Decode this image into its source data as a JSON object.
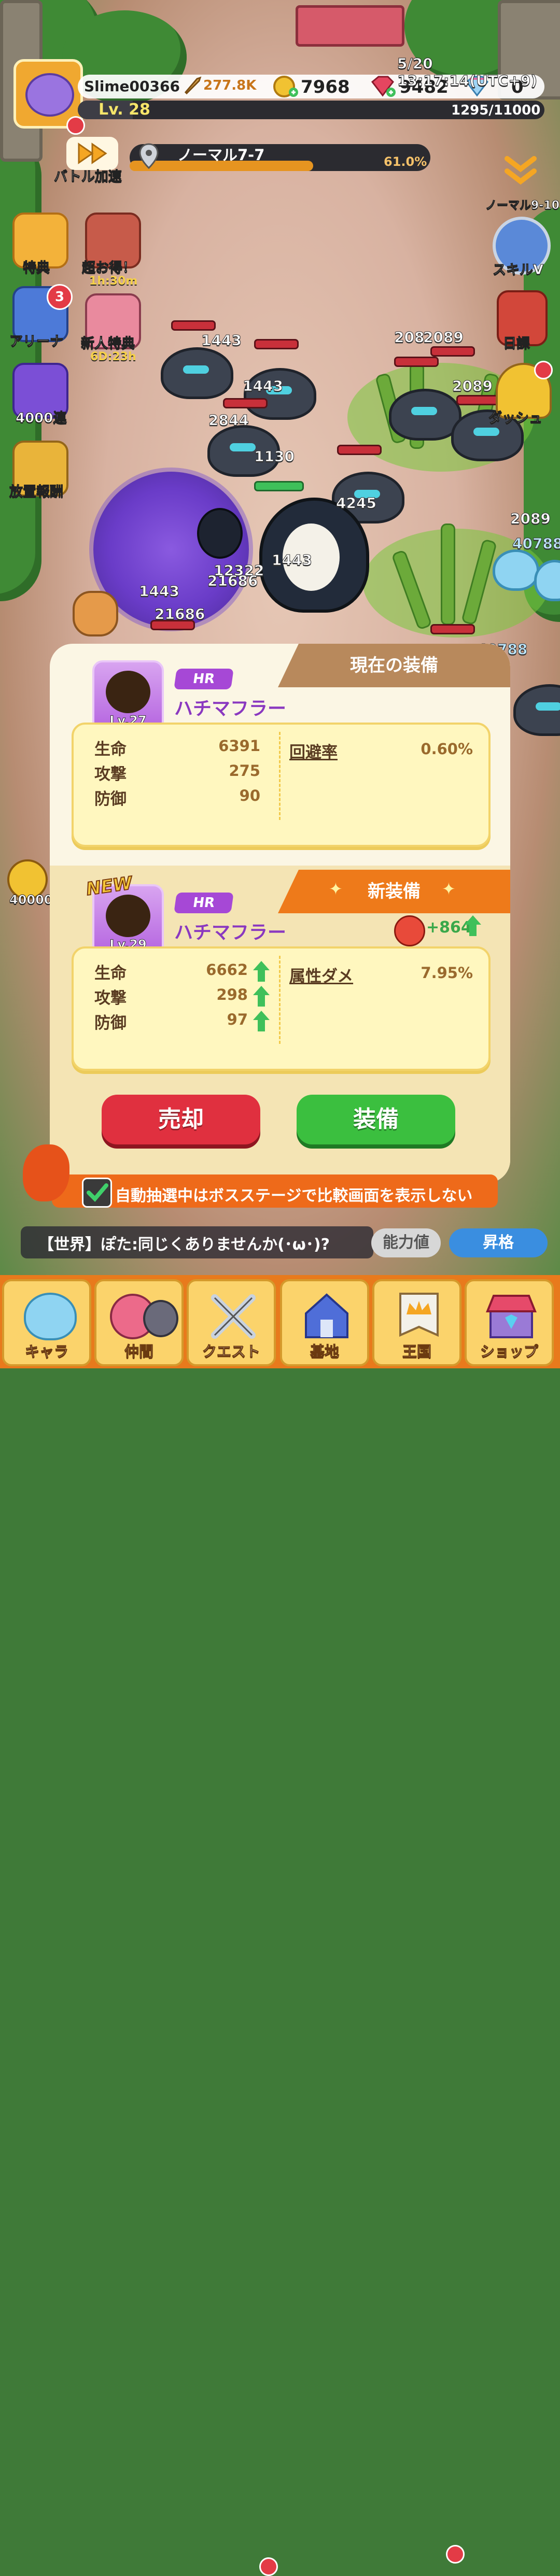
{
  "player": {
    "name": "Slime00366",
    "power": "277.8K",
    "level": "Lv. 28",
    "exp": "1295/11000",
    "exp_fraction": 0.1177
  },
  "currencies": {
    "gold": "7968",
    "gems": "9482",
    "diamonds": "0"
  },
  "server_time": "5/20 13:17:14(UTC+9)",
  "stage": {
    "name": "ノーマル7-7",
    "progress_label": "61.0%",
    "progress_fraction": 0.61,
    "next_stage": "ノーマル9-10"
  },
  "battle_speed_label": "バトル加速",
  "left_menu": {
    "perks": "特典",
    "super_deal": "超お得！",
    "super_deal_timer": "1h:30m",
    "arena": "アリーナ",
    "arena_badge": "3",
    "newbie_perks": "新人特典",
    "newbie_timer": "6D:23h",
    "draw_4000": "4000連",
    "idle_reward": "放置報酬",
    "gold_amount": "40000"
  },
  "right_menu": {
    "skill": "スキルV",
    "daily": "日課",
    "dash": "ダッシュ"
  },
  "damage_numbers": [
    "1443",
    "208",
    "2089",
    "1443",
    "2089",
    "2844",
    "1130",
    "4245",
    "2089",
    "40788",
    "12322",
    "21686",
    "1443",
    "1443",
    "21686",
    "40788"
  ],
  "current_equipment": {
    "header": "現在の装備",
    "rarity": "HR",
    "name": "ハチマフラー",
    "level": "Lv.27",
    "stats": [
      {
        "label": "生命",
        "value": "6391"
      },
      {
        "label": "攻撃",
        "value": "275"
      },
      {
        "label": "防御",
        "value": "90"
      }
    ],
    "sub_stat_label": "回避率",
    "sub_stat_value": "0.60%"
  },
  "new_equipment": {
    "header": "新装備",
    "new_badge": "NEW",
    "rarity": "HR",
    "name": "ハチマフラー",
    "level": "Lv.29",
    "power_diff": "+864",
    "stats": [
      {
        "label": "生命",
        "value": "6662"
      },
      {
        "label": "攻撃",
        "value": "298"
      },
      {
        "label": "防御",
        "value": "97"
      }
    ],
    "sub_stat_label": "属性ダメ",
    "sub_stat_value": "7.95%"
  },
  "buttons": {
    "sell": "売却",
    "equip": "装備"
  },
  "auto_notice": "自動抽選中はボスステージで比較画面を表示しない",
  "chat": {
    "message": "【世界】ぽた:同じくありませんか(･ω･)?",
    "stats_button": "能力値",
    "promote_button": "昇格"
  },
  "nav": {
    "chara": "キャラ",
    "friends": "仲間",
    "quest": "クエスト",
    "base": "基地",
    "kingdom": "王国",
    "shop": "ショップ"
  },
  "colors": {
    "sell_red": "#e0303f",
    "equip_green": "#3bbf3f",
    "new_orange": "#ee7a1a",
    "rarity_purple": "#a648d6"
  }
}
